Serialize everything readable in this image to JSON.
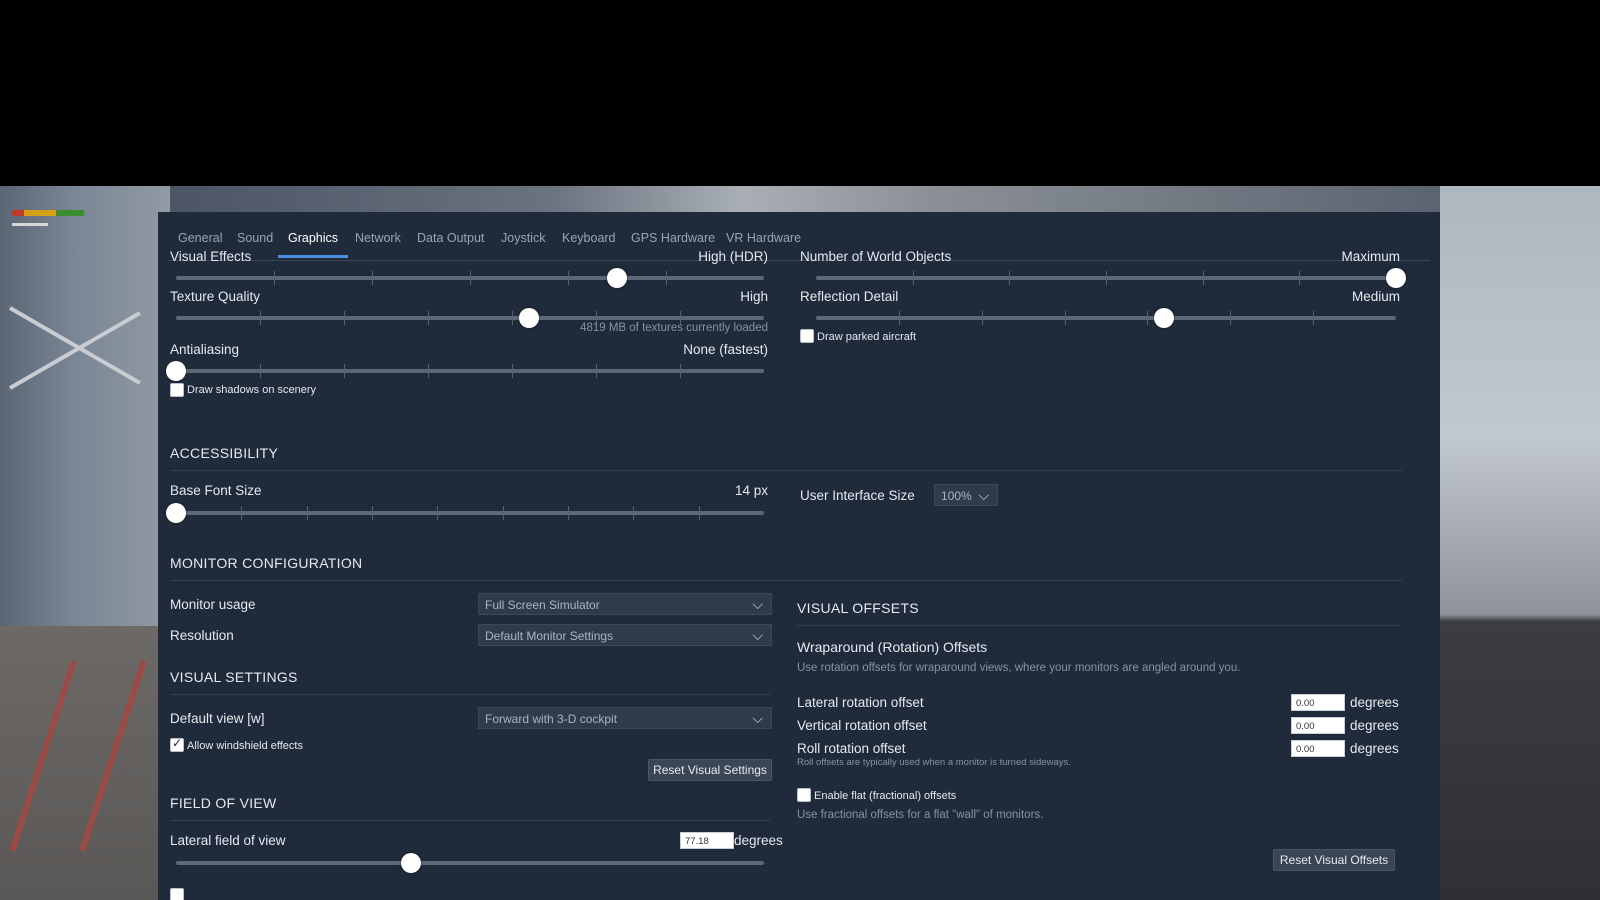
{
  "tabs": [
    "General",
    "Sound",
    "Graphics",
    "Network",
    "Data Output",
    "Joystick",
    "Keyboard",
    "GPS Hardware",
    "VR Hardware"
  ],
  "active_tab": "Graphics",
  "graphics": {
    "visual_effects": {
      "label": "Visual Effects",
      "value": "High (HDR)",
      "level": 0.75
    },
    "texture_quality": {
      "label": "Texture Quality",
      "value": "High",
      "level": 0.6,
      "note": "4819 MB of textures currently loaded"
    },
    "antialiasing": {
      "label": "Antialiasing",
      "value": "None (fastest)",
      "level": 0.0
    },
    "draw_shadows": {
      "label": "Draw shadows on scenery",
      "checked": false
    },
    "world_objects": {
      "label": "Number of World Objects",
      "value": "Maximum",
      "level": 1.0
    },
    "reflection_detail": {
      "label": "Reflection Detail",
      "value": "Medium",
      "level": 0.6
    },
    "draw_parked": {
      "label": "Draw parked aircraft",
      "checked": false
    }
  },
  "accessibility": {
    "title": "ACCESSIBILITY",
    "base_font": {
      "label": "Base Font Size",
      "value": "14 px",
      "level": 0.0
    },
    "ui_size": {
      "label": "User Interface Size",
      "value": "100%"
    }
  },
  "monitor": {
    "title": "MONITOR CONFIGURATION",
    "usage": {
      "label": "Monitor usage",
      "value": "Full Screen Simulator"
    },
    "resolution": {
      "label": "Resolution",
      "value": "Default Monitor Settings"
    }
  },
  "visual_settings": {
    "title": "VISUAL SETTINGS",
    "default_view": {
      "label": "Default view [w]",
      "value": "Forward with 3-D cockpit"
    },
    "windshield": {
      "label": "Allow windshield effects",
      "checked": true
    },
    "reset_label": "Reset Visual Settings"
  },
  "fov": {
    "title": "FIELD OF VIEW",
    "lateral": {
      "label": "Lateral field of view",
      "value": "77.18",
      "unit": "degrees",
      "level": 0.4
    }
  },
  "visual_offsets": {
    "title": "VISUAL OFFSETS",
    "wrap_title": "Wraparound (Rotation) Offsets",
    "wrap_note": "Use rotation offsets for wraparound views, where your monitors are angled around you.",
    "lateral": {
      "label": "Lateral rotation offset",
      "value": "0.00",
      "unit": "degrees"
    },
    "vertical": {
      "label": "Vertical rotation offset",
      "value": "0.00",
      "unit": "degrees"
    },
    "roll": {
      "label": "Roll rotation offset",
      "value": "0.00",
      "unit": "degrees"
    },
    "roll_note": "Roll offsets are typically used when a monitor is turned sideways.",
    "flat": {
      "label": "Enable flat (fractional) offsets",
      "checked": false
    },
    "flat_note": "Use fractional offsets for a flat \"wall\" of monitors.",
    "reset_label": "Reset Visual Offsets"
  },
  "colors": {
    "panel": "#1f2b3a",
    "accent": "#4b8fe0",
    "track": "#5d6877"
  }
}
